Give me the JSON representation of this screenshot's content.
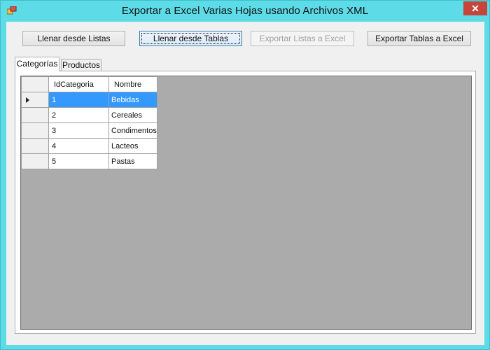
{
  "window": {
    "title": "Exportar a Excel Varias Hojas usando Archivos XML",
    "close_glyph": "✕",
    "accent_color": "#5ddbe7",
    "close_color": "#c7443a"
  },
  "toolbar": {
    "fill_lists_label": "Llenar desde Listas",
    "fill_tables_label": "Llenar desde Tablas",
    "export_lists_label": "Exportar Listas a Excel",
    "export_tables_label": "Exportar Tablas a Excel"
  },
  "tabs": [
    {
      "label": "Categorías",
      "active": true
    },
    {
      "label": "Productos",
      "active": false
    }
  ],
  "grid": {
    "columns": [
      "IdCategoria",
      "Nombre"
    ],
    "rows": [
      {
        "id": "1",
        "name": "Bebidas",
        "selected": true
      },
      {
        "id": "2",
        "name": "Cereales",
        "selected": false
      },
      {
        "id": "3",
        "name": "Condimentos",
        "selected": false
      },
      {
        "id": "4",
        "name": "Lacteos",
        "selected": false
      },
      {
        "id": "5",
        "name": "Pastas",
        "selected": false
      }
    ],
    "selection_color": "#3399ff"
  }
}
